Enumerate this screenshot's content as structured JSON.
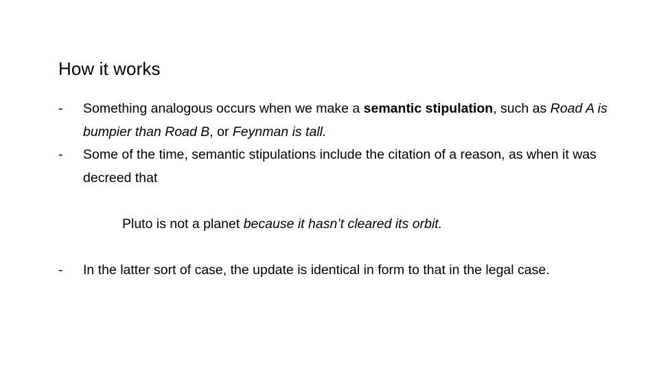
{
  "slide": {
    "title": "How it works",
    "bullets": [
      {
        "marker": "-",
        "segments": [
          {
            "text": "Something analogous occurs when we make a ",
            "style": "normal"
          },
          {
            "text": "semantic stipulation",
            "style": "bold"
          },
          {
            "text": ", such as ",
            "style": "normal"
          },
          {
            "text": "Road A is bumpier than Road B",
            "style": "italic"
          },
          {
            "text": ", or ",
            "style": "normal"
          },
          {
            "text": "Feynman is tall.",
            "style": "italic"
          }
        ],
        "plain_text": "Something analogous occurs when we make a semantic stipulation, such as Road A is bumpier than Road B, or Feynman is tall."
      },
      {
        "marker": "-",
        "segments": [
          {
            "text": "Some of the time, semantic stipulations include the citation of a reason, as when it was decreed that",
            "style": "normal"
          }
        ],
        "plain_text": "Some of the time, semantic stipulations include the citation of a reason, as when it was decreed that"
      }
    ],
    "quote": {
      "segments": [
        {
          "text": "Pluto is not a planet ",
          "style": "normal"
        },
        {
          "text": "because it hasn’t cleared its orbit.",
          "style": "italic"
        }
      ],
      "plain_text": "Pluto is not a planet because it hasn’t cleared its orbit."
    },
    "bullets_after": [
      {
        "marker": "-",
        "segments": [
          {
            "text": "In the latter sort of case, the update is identical in form to that in the legal case.",
            "style": "normal"
          }
        ],
        "plain_text": "In the latter sort of case, the update is identical in form to that in the legal case."
      }
    ],
    "colors": {
      "background": "#ffffff",
      "text": "#000000"
    }
  }
}
